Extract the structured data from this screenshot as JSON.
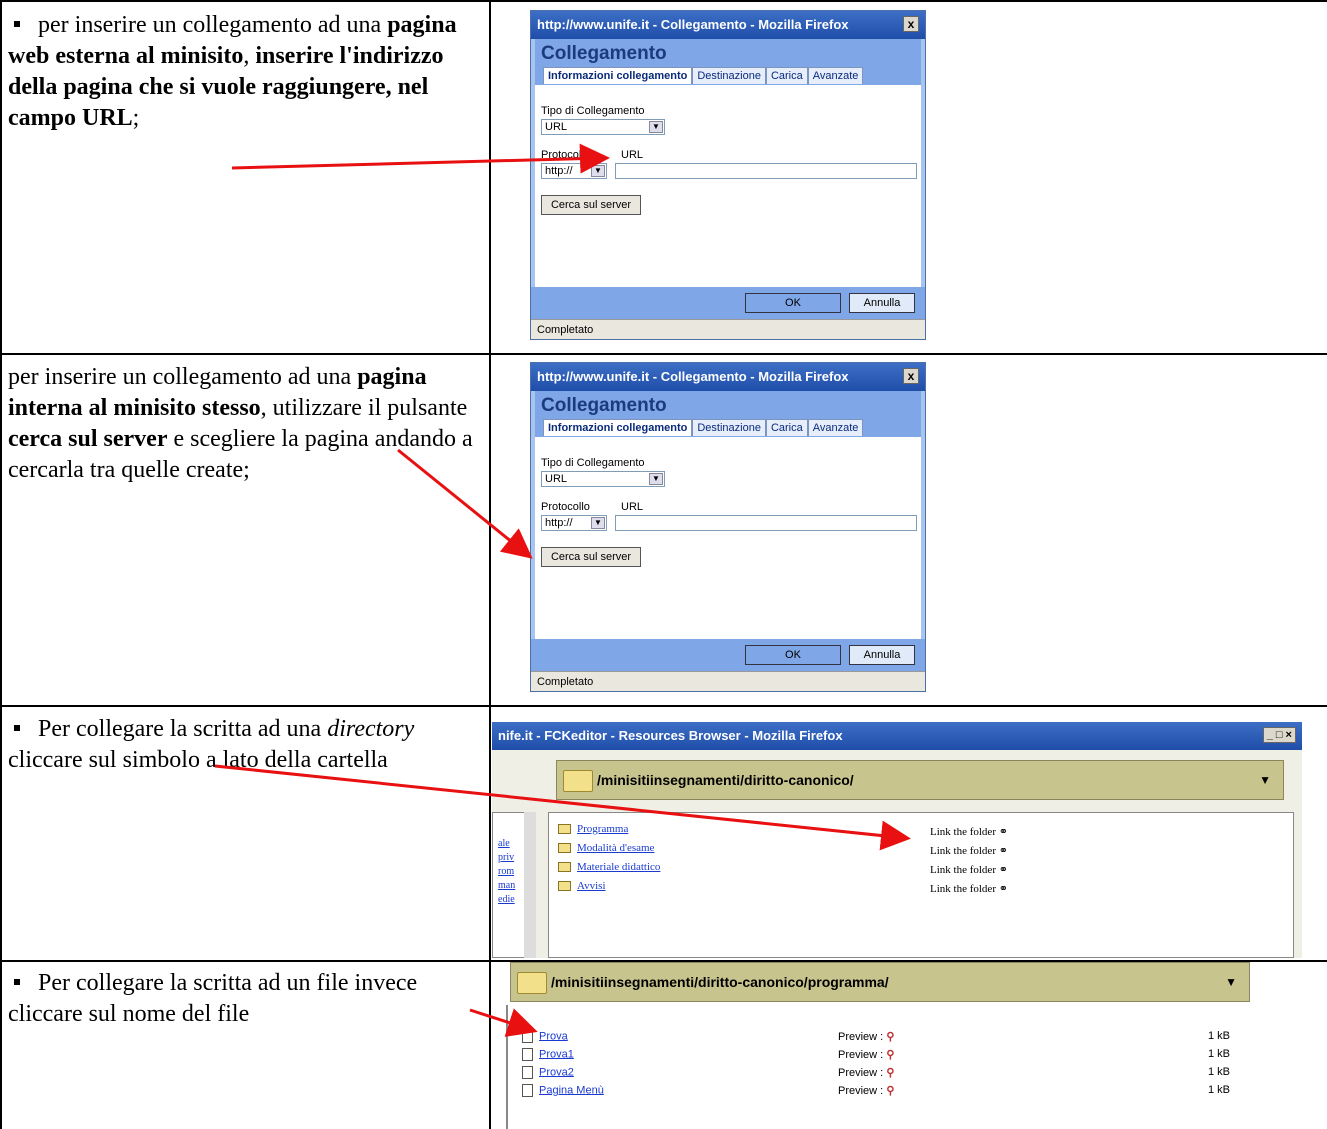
{
  "row1": {
    "text_parts": [
      " per inserire un collegamento ad una ",
      "pagina web esterna al minisito",
      ", ",
      "inserire l'indirizzo della pagina che si vuole raggiungere, nel campo URL",
      ";"
    ]
  },
  "row2": {
    "text_parts": [
      "per inserire un collegamento ad una ",
      "pagina interna al minisito stesso",
      ", utilizzare il pulsante ",
      "cerca sul server",
      " e scegliere la pagina andando a cercarla tra quelle create;"
    ]
  },
  "row3": {
    "text_parts": [
      " Per collegare la scritta ad una ",
      "directory",
      " cliccare sul simbolo a lato della cartella"
    ]
  },
  "row4": {
    "text": " Per collegare la scritta ad un file invece cliccare sul nome del file"
  },
  "dialog": {
    "title": "http://www.unife.it - Collegamento - Mozilla Firefox",
    "close": "x",
    "heading": "Collegamento",
    "tabs": [
      "Informazioni collegamento",
      "Destinazione",
      "Carica",
      "Avanzate"
    ],
    "tipo_label": "Tipo di Collegamento",
    "tipo_value": "URL",
    "protocollo_label": "Protocollo",
    "url_label": "URL",
    "protocollo_value": "http://",
    "search_button": "Cerca sul server",
    "ok": "OK",
    "cancel": "Annulla",
    "status": "Completato"
  },
  "browser": {
    "title": "nife.it - FCKeditor - Resources Browser - Mozilla Firefox",
    "path1": "/minisitiinsegnamenti/diritto-canonico/",
    "folders": [
      "Programma",
      "Modalità d'esame",
      "Materiale didattico",
      "Avvisi"
    ],
    "link_label": "Link the folder",
    "side_links": [
      "ale",
      "priv",
      "rom",
      "man",
      "edie"
    ],
    "path2": "/minisitiinsegnamenti/diritto-canonico/programma/",
    "files": [
      "Prova",
      "Prova1",
      "Prova2",
      "Pagina Menù"
    ],
    "preview_label": "Preview :",
    "size": "1 kB"
  },
  "colors": {
    "arrow": "#e81010",
    "dialog_blue": "#7fa6e6"
  }
}
